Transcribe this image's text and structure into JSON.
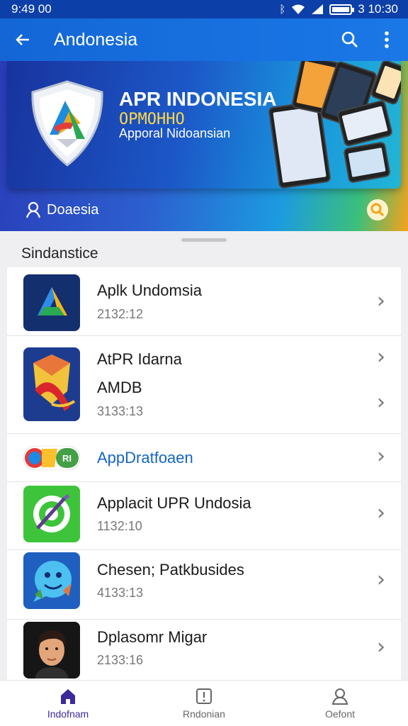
{
  "status_bar": {
    "time": "9:49 00",
    "right_time": "3 10:30",
    "battery_level": 1.0
  },
  "app_bar": {
    "title": "Andonesia"
  },
  "hero": {
    "title": "APR INDONESIA",
    "subtitle": "OPMOHHO",
    "tagline": "Apporal Nidoansian",
    "search_label": "Doaesia"
  },
  "section": {
    "title": "Sindanstice"
  },
  "apps": [
    {
      "title": "Aplk Undomsia",
      "sub": "2132:12",
      "icon": "triangle-logo-icon"
    },
    {
      "title": "AtPR Idarna",
      "line2": "AMDB",
      "sub": "3133:13",
      "icon": "shield-ribbon-icon"
    },
    {
      "title": "AppDratfoaen",
      "icon": "colorful-badge-icon",
      "accent": "#1565c0"
    },
    {
      "title": "Applacit UPR Undosia",
      "sub": "1132:10",
      "icon": "green-target-icon"
    },
    {
      "title": "Chesen; Patkbusides",
      "sub": "4133:13",
      "icon": "chat-bubble-icon"
    },
    {
      "title": "Dplasomr Migar",
      "sub": "2133:16",
      "icon": "person-avatar-icon"
    }
  ],
  "bottom_nav": [
    {
      "label": "Indofnam",
      "icon": "home-icon",
      "active": true
    },
    {
      "label": "Rndonian",
      "icon": "info-icon",
      "active": false
    },
    {
      "label": "Oefont",
      "icon": "profile-icon",
      "active": false
    }
  ],
  "colors": {
    "primary": "#1466d6",
    "status_bar": "#0c3fa8",
    "active_nav": "#3b2a9a",
    "link_text": "#1565c0"
  }
}
